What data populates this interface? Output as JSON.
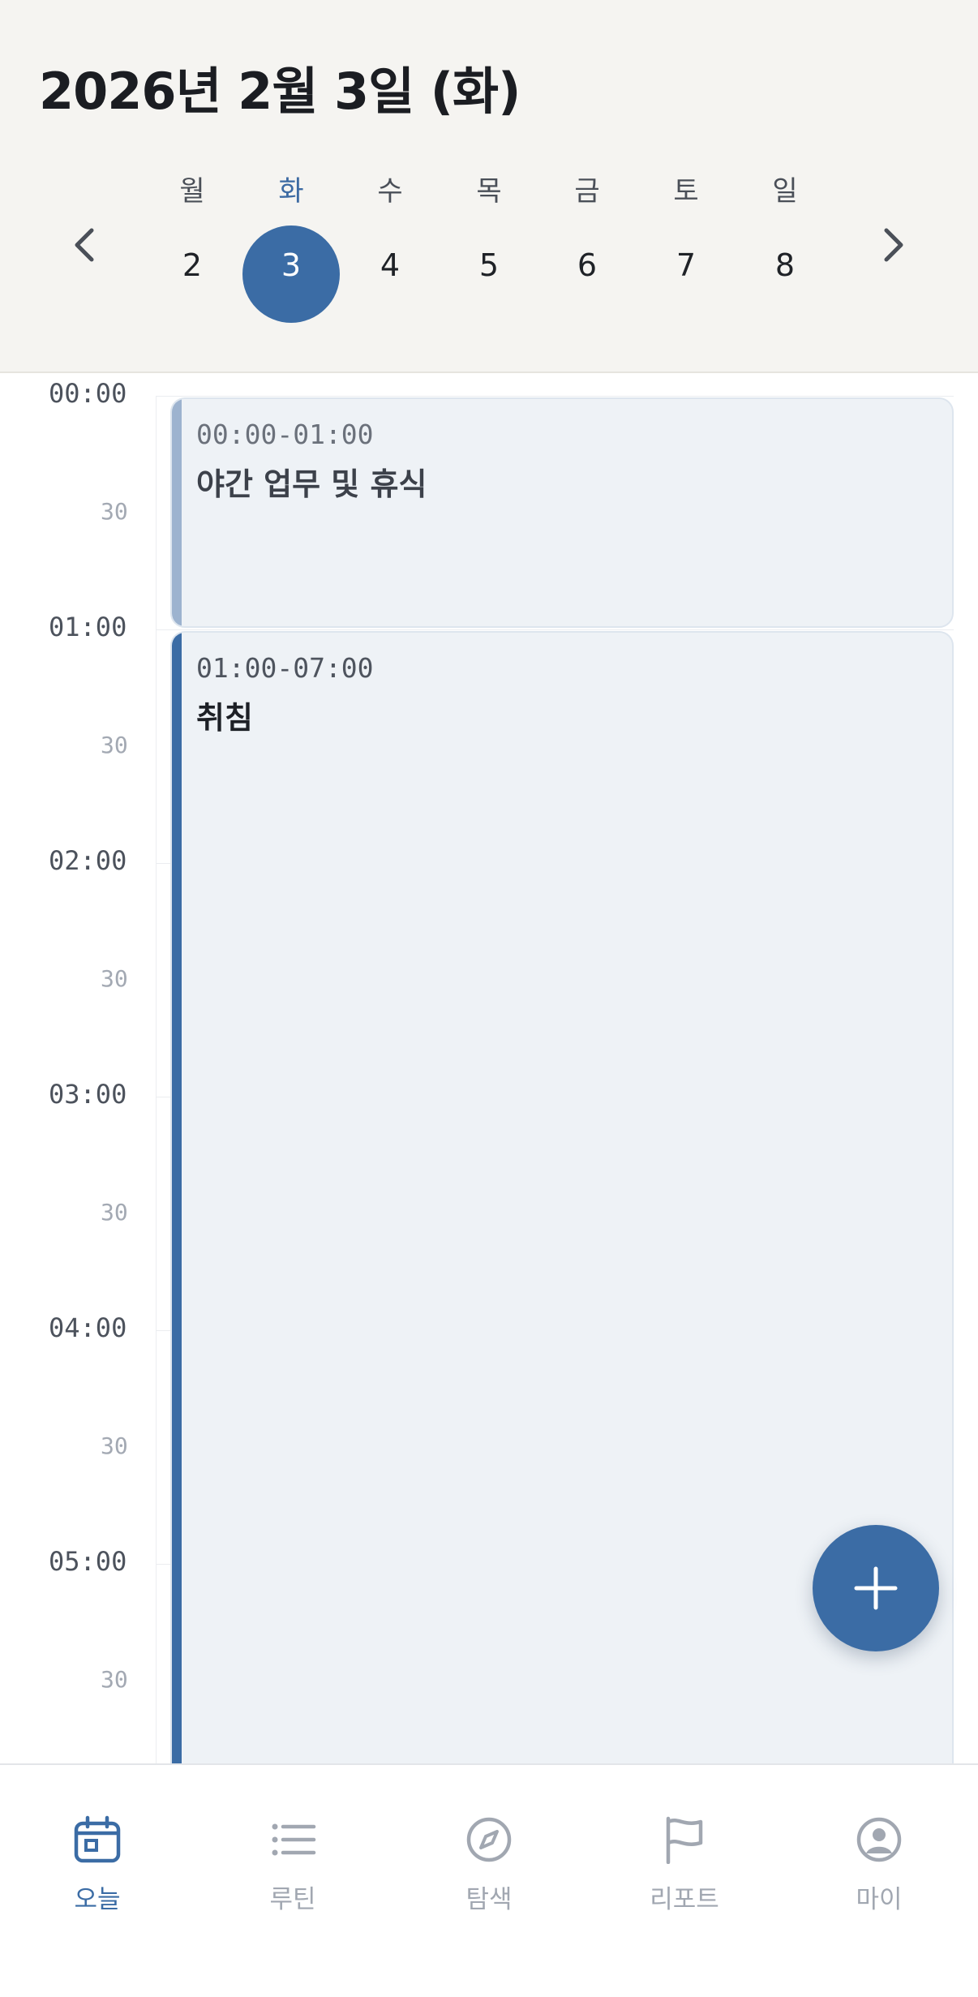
{
  "header": {
    "date_title": "2026년 2월 3일 (화)",
    "prev_week_icon": "chevron-left-icon",
    "next_week_icon": "chevron-right-icon"
  },
  "week": [
    {
      "label": "월",
      "date": "2",
      "selected": false
    },
    {
      "label": "화",
      "date": "3",
      "selected": true
    },
    {
      "label": "수",
      "date": "4",
      "selected": false
    },
    {
      "label": "목",
      "date": "5",
      "selected": false
    },
    {
      "label": "금",
      "date": "6",
      "selected": false
    },
    {
      "label": "토",
      "date": "7",
      "selected": false
    },
    {
      "label": "일",
      "date": "8",
      "selected": false
    }
  ],
  "timeline": {
    "hour_labels": [
      "00:00",
      "01:00",
      "02:00",
      "03:00",
      "04:00",
      "05:00"
    ],
    "half_label": "30"
  },
  "events": [
    {
      "time": "00:00-01:00",
      "title": "야간 업무 및 휴식",
      "accent": "#9db3cf"
    },
    {
      "time": "01:00-07:00",
      "title": "취침",
      "accent": "#3b6ca5"
    }
  ],
  "fab": {
    "icon": "plus-icon"
  },
  "colors": {
    "accent": "#3b6ca5",
    "header_bg": "#f5f4f1",
    "event_bg": "#eef2f6",
    "inactive": "#a1a7b1"
  },
  "bottom_nav": [
    {
      "label": "오늘",
      "icon": "calendar-icon",
      "active": true
    },
    {
      "label": "루틴",
      "icon": "list-icon",
      "active": false
    },
    {
      "label": "탐색",
      "icon": "compass-icon",
      "active": false
    },
    {
      "label": "리포트",
      "icon": "flag-icon",
      "active": false
    },
    {
      "label": "마이",
      "icon": "user-circle-icon",
      "active": false
    }
  ]
}
